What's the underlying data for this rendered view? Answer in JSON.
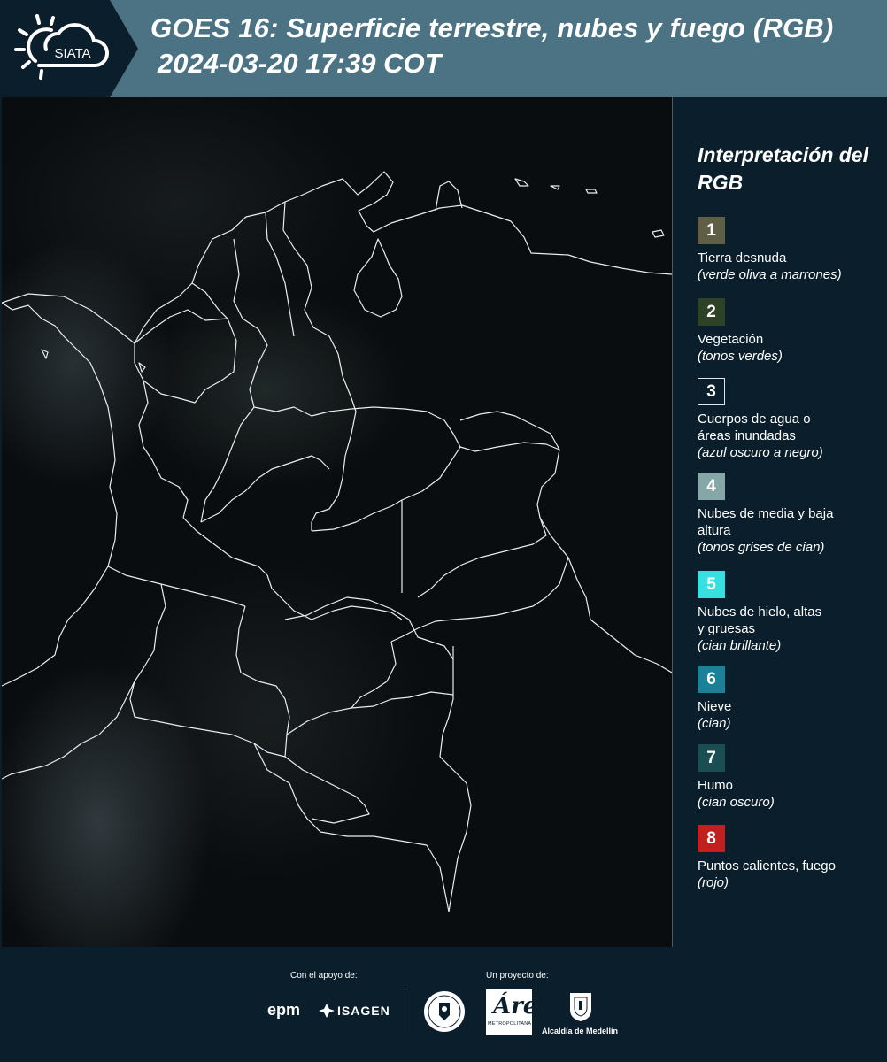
{
  "header": {
    "logo_text": "SIATA",
    "title_line1": "GOES 16: Superficie terrestre, nubes y fuego (RGB)",
    "title_line2": "2024-03-20 17:39 COT"
  },
  "legend": {
    "title": "Interpretación del RGB",
    "items": [
      {
        "number": "1",
        "label": "Tierra desnuda",
        "sub": "(verde oliva a marrones)",
        "color": "#5f5f45"
      },
      {
        "number": "2",
        "label": "Vegetación",
        "sub": "(tonos verdes)",
        "color": "#2e4226"
      },
      {
        "number": "3",
        "label": "Cuerpos de agua o áreas inundadas",
        "sub": "(azul oscuro a negro)",
        "color": "#0b1e2b"
      },
      {
        "number": "4",
        "label": "Nubes de media y baja altura",
        "sub": "(tonos grises de cian)",
        "color": "#86a7a7"
      },
      {
        "number": "5",
        "label": "Nubes de hielo, altas y gruesas",
        "sub": "(cian brillante)",
        "color": "#36e0e0"
      },
      {
        "number": "6",
        "label": "Nieve",
        "sub": "(cian)",
        "color": "#1a8196"
      },
      {
        "number": "7",
        "label": "Humo",
        "sub": "(cian oscuro)",
        "color": "#1b4e52"
      },
      {
        "number": "8",
        "label": "Puntos calientes, fuego",
        "sub": "(rojo)",
        "color": "#c21f1f"
      }
    ]
  },
  "footer": {
    "support_label": "Con el apoyo de:",
    "project_label": "Un proyecto de:",
    "epm": "epm",
    "isagen": "ISAGEN",
    "area_letter": "Área",
    "area_sub": "METROPOLITANA",
    "alcaldia": "Alcaldía de Medellín"
  }
}
